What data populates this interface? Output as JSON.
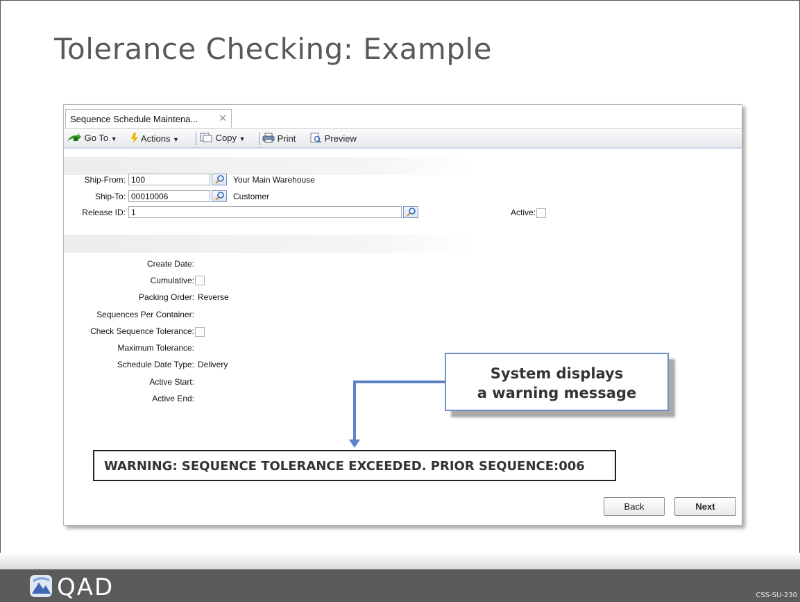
{
  "slide": {
    "title": "Tolerance Checking: Example",
    "code": "CSS-SU-230",
    "logo_text": "QAD"
  },
  "window": {
    "tab_label": "Sequence Schedule Maintena...",
    "toolbar": {
      "goto_label": "Go To",
      "actions_label": "Actions",
      "copy_label": "Copy",
      "print_label": "Print",
      "preview_label": "Preview"
    },
    "form": {
      "ship_from_label": "Ship-From:",
      "ship_from_value": "100",
      "ship_from_desc": "Your Main Warehouse",
      "ship_to_label": "Ship-To:",
      "ship_to_value": "00010006",
      "ship_to_desc": "Customer",
      "release_id_label": "Release ID:",
      "release_id_value": "1",
      "active_label": "Active:",
      "active_checked": false
    },
    "details": {
      "create_date_label": "Create Date:",
      "cumulative_label": "Cumulative:",
      "cumulative_checked": false,
      "packing_order_label": "Packing Order:",
      "packing_order_value": "Reverse",
      "seq_per_container_label": "Sequences Per Container:",
      "check_seq_tolerance_label": "Check Sequence Tolerance:",
      "check_seq_tolerance_checked": false,
      "max_tolerance_label": "Maximum Tolerance:",
      "schedule_date_type_label": "Schedule Date Type:",
      "schedule_date_type_value": "Delivery",
      "active_start_label": "Active Start:",
      "active_end_label": "Active End:"
    },
    "buttons": {
      "back_label": "Back",
      "next_label": "Next"
    }
  },
  "callout": {
    "line1": "System displays",
    "line2": "a warning message"
  },
  "warning": {
    "text": "WARNING: SEQUENCE TOLERANCE EXCEEDED. PRIOR SEQUENCE:006"
  },
  "colors": {
    "accent_blue": "#5b83c7",
    "footer_gray": "#5b5b5b",
    "title_gray": "#595959"
  }
}
